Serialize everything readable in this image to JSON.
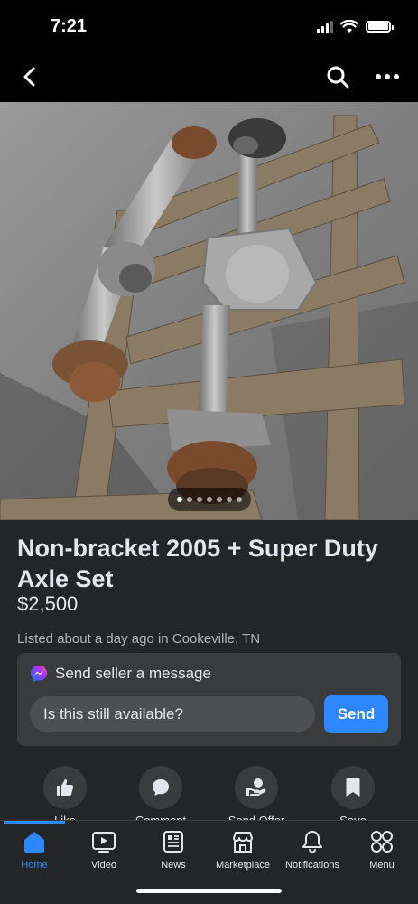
{
  "status": {
    "time": "7:21"
  },
  "listing": {
    "title": "Non-bracket 2005 + Super Duty Axle Set",
    "price": "$2,500",
    "listed": "Listed about a day ago in Cookeville, TN",
    "photo_count": 7,
    "photo_current": 1
  },
  "message": {
    "header": "Send seller a message",
    "input_value": "Is this still available?",
    "send_label": "Send"
  },
  "actions": [
    {
      "label": "Like",
      "icon": "thumbs-up-icon"
    },
    {
      "label": "Comment",
      "icon": "comment-icon"
    },
    {
      "label": "Send Offer",
      "icon": "send-offer-icon"
    },
    {
      "label": "Save",
      "icon": "bookmark-icon"
    }
  ],
  "tabs": [
    {
      "label": "Home",
      "icon": "home-icon",
      "active": true
    },
    {
      "label": "Video",
      "icon": "video-icon"
    },
    {
      "label": "News",
      "icon": "news-icon"
    },
    {
      "label": "Marketplace",
      "icon": "marketplace-icon"
    },
    {
      "label": "Notifications",
      "icon": "bell-icon"
    },
    {
      "label": "Menu",
      "icon": "menu-grid-icon"
    }
  ],
  "colors": {
    "accent": "#2d88ff",
    "background": "#242526",
    "card": "#3a3b3c"
  }
}
